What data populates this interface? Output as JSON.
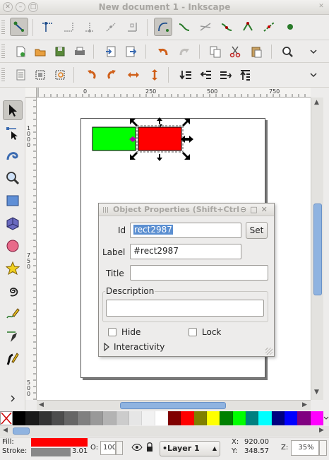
{
  "window": {
    "title": "New document 1 - Inkscape"
  },
  "toolbars": {
    "snap_icons": [
      "snap-toggle-icon",
      "snap-bbox-icon",
      "snap-bbox-edge-icon",
      "snap-bbox-corner-icon",
      "snap-bbox-midpoint-icon",
      "snap-bbox-center-icon",
      "snap-nodes-icon",
      "snap-path-icon",
      "snap-intersection-icon",
      "snap-smooth-icon",
      "snap-midpoint-icon",
      "snap-object-center-icon",
      "snap-rotation-center-icon",
      "snap-page-icon"
    ],
    "commands_icons": [
      "new-document-icon",
      "open-icon",
      "save-icon",
      "print-icon",
      "import-icon",
      "export-icon",
      "undo-icon",
      "redo-icon",
      "copy-icon",
      "cut-icon",
      "paste-icon",
      "zoom-fit-icon"
    ],
    "select_icons": [
      "select-all-icon",
      "select-all-layers-icon",
      "deselect-icon",
      "rotate-ccw-icon",
      "rotate-cw-icon",
      "flip-horizontal-icon",
      "flip-vertical-icon",
      "lower-bottom-icon",
      "lower-icon",
      "raise-icon",
      "raise-top-icon"
    ]
  },
  "rulers": {
    "top_labels": [
      "0",
      "250",
      "500",
      "750"
    ],
    "left_labels": [
      "1000",
      "750",
      "500"
    ]
  },
  "canvas": {
    "green_rect_color": "#00ff00",
    "red_rect_color": "#ff0000"
  },
  "dialog": {
    "title": "Object Properties (Shift+Ctrl+O)",
    "id_label": "Id",
    "id_value": "rect2987",
    "set_button": "Set",
    "label_label": "Label",
    "label_value": "#rect2987",
    "title_label": "Title",
    "title_value": "",
    "description_label": "Description",
    "description_value": "",
    "hide_label": "Hide",
    "lock_label": "Lock",
    "interactivity_label": "Interactivity"
  },
  "palette": [
    "#000000",
    "#1a1a1a",
    "#333333",
    "#4d4d4d",
    "#666666",
    "#808080",
    "#999999",
    "#b3b3b3",
    "#cccccc",
    "#e6e6e6",
    "#f2f2f2",
    "#ffffff",
    "#800000",
    "#ff0000",
    "#808000",
    "#ffff00",
    "#008000",
    "#00ff00",
    "#008080",
    "#00ffff",
    "#000080",
    "#0000ff",
    "#800080",
    "#ff00ff"
  ],
  "statusbar": {
    "fill_label": "Fill:",
    "stroke_label": "Stroke:",
    "fill_color": "#ff0000",
    "stroke_width": "3.01",
    "opacity_label": "O:",
    "opacity_value": "100",
    "layer_value": "•Layer 1",
    "x_label": "X:",
    "x_value": "920.00",
    "y_label": "Y:",
    "y_value": "348.57",
    "zoom_label": "Z:",
    "zoom_value": "35%"
  }
}
